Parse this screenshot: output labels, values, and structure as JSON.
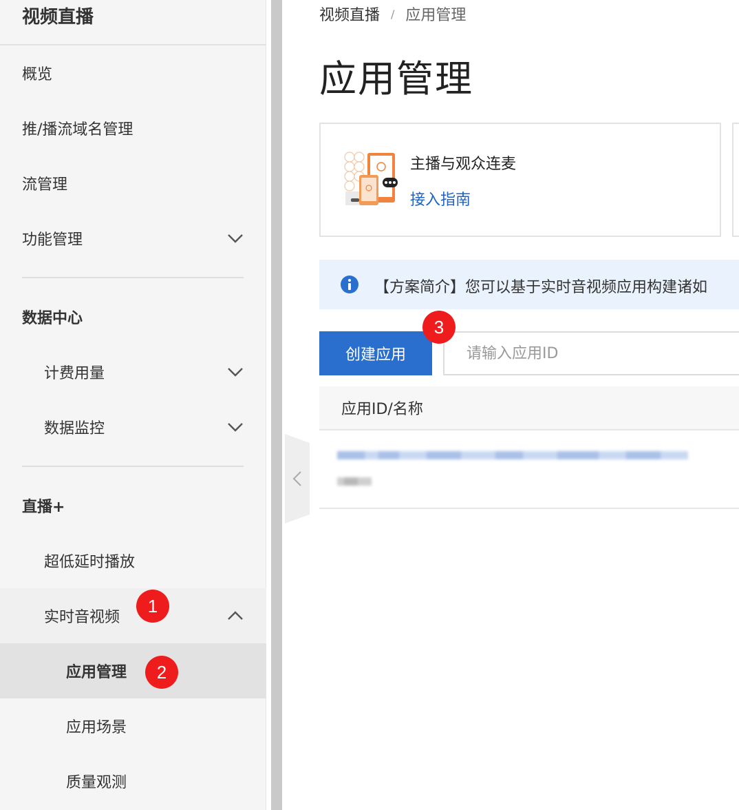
{
  "sidebar": {
    "title": "视频直播",
    "items": [
      {
        "label": "概览"
      },
      {
        "label": "推/播流域名管理"
      },
      {
        "label": "流管理"
      },
      {
        "label": "功能管理"
      },
      {
        "label": "数据中心"
      },
      {
        "label": "计费用量"
      },
      {
        "label": "数据监控"
      },
      {
        "label": "直播+"
      },
      {
        "label": "超低延时播放"
      },
      {
        "label": "实时音视频"
      },
      {
        "label": "应用管理"
      },
      {
        "label": "应用场景"
      },
      {
        "label": "质量观测"
      }
    ]
  },
  "main": {
    "breadcrumb": [
      "视频直播",
      "/",
      "应用管理"
    ],
    "page_title": "应用管理",
    "card": {
      "title": "主播与观众连麦",
      "link": "接入指南"
    },
    "notice": {
      "text": "【方案简介】您可以基于实时音视频应用构建诸如"
    },
    "create_button": "创建应用",
    "search_placeholder": "请输入应用ID",
    "table": {
      "header": "应用ID/名称"
    }
  },
  "annotations": {
    "badge1": "1",
    "badge2": "2",
    "badge3": "3"
  },
  "colors": {
    "primary": "#2b6fce",
    "link": "#1e63c4",
    "badge": "#ee1c1c",
    "notice_bg": "#eaf3fd",
    "info_icon": "#2b6fce"
  }
}
